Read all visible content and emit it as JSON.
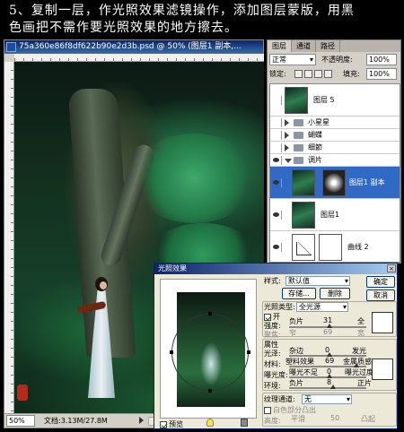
{
  "caption": {
    "line1": "5、复制一层，作光照效果滤镜操作，添加图层蒙版，用黑",
    "line2": "色画把不需作要光照效果的地方擦去。"
  },
  "document": {
    "title": "75a360e86f8df622b90e2d3b.psd @ 50% (图层1 副本,...",
    "zoom": "50%",
    "doc_info": "文档:3.13M/27.8M"
  },
  "layers_panel": {
    "tabs": [
      "图层",
      "通道",
      "路径"
    ],
    "blend_mode": "正常",
    "opacity_label": "不透明度:",
    "opacity": "100%",
    "lock_label": "锁定:",
    "fill_label": "填充:",
    "fill": "100%",
    "layers": [
      {
        "name": "图层 5",
        "type": "image",
        "visible": false
      },
      {
        "name": "小星星",
        "type": "group",
        "visible": false
      },
      {
        "name": "蝴蝶",
        "type": "group",
        "visible": false
      },
      {
        "name": "细節",
        "type": "group",
        "visible": false
      },
      {
        "name": "调片",
        "type": "group",
        "visible": true,
        "open": true
      },
      {
        "name": "图层1 副本",
        "type": "image-mask",
        "visible": true,
        "selected": true
      },
      {
        "name": "图层1",
        "type": "image",
        "visible": true
      },
      {
        "name": "曲线 2",
        "type": "adjustment",
        "visible": true
      }
    ]
  },
  "lighting_dialog": {
    "title": "光照效果",
    "style_label": "样式:",
    "style_value": "默认值",
    "save_label": "存储...",
    "delete_label": "删除",
    "ok_label": "确定",
    "cancel_label": "取消",
    "light_type_label": "光照类型:",
    "light_type_value": "全光源",
    "on_label": "开",
    "intensity_label": "强度:",
    "intensity_min": "负片",
    "intensity_value": "31",
    "intensity_max": "全",
    "focus_label": "聚焦:",
    "focus_min": "窄",
    "focus_value": "69",
    "focus_max": "宽",
    "properties_label": "属性",
    "gloss_label": "光泽:",
    "gloss_min": "杂边",
    "gloss_value": "0",
    "gloss_max": "发光",
    "material_label": "材料:",
    "material_min": "塑料效果",
    "material_value": "69",
    "material_max": "金属质感",
    "exposure_label": "曝光度:",
    "exposure_min": "曝光不足",
    "exposure_value": "0",
    "exposure_max": "曝光过度",
    "ambience_label": "环境:",
    "ambience_min": "负片",
    "ambience_value": "8",
    "ambience_max": "正片",
    "texture_label": "纹理通道:",
    "texture_value": "无",
    "white_high_label": "白色部分凸出",
    "height_label": "高度:",
    "height_min": "平滑",
    "height_value": "50",
    "height_max": "凸起",
    "preview_label": "预览"
  }
}
